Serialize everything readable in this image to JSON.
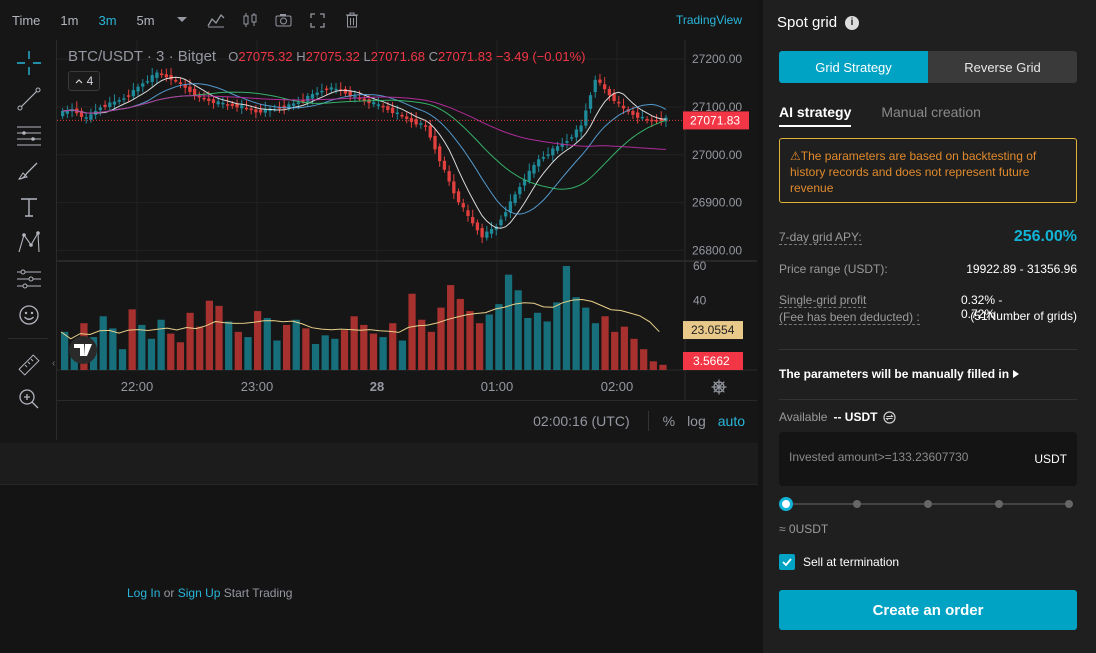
{
  "toolbar": {
    "time_label": "Time",
    "intervals": [
      "1m",
      "3m",
      "5m"
    ],
    "active_interval": "3m",
    "tradingview_label": "TradingView"
  },
  "chart": {
    "symbol": "BTC/USDT · 3 · Bitget",
    "ohlc": {
      "o_label": "O",
      "o": "27075.32",
      "h_label": "H",
      "h": "27075.32",
      "l_label": "L",
      "l": "27071.68",
      "c_label": "C",
      "c": "27071.83",
      "change": "−3.49 (−0.01%)"
    },
    "indicator_count": "4",
    "price_axis": [
      "27200.00",
      "27100.00",
      "27000.00",
      "26900.00",
      "26800.00"
    ],
    "last_price_badge": "27071.83",
    "volume_axis": [
      "60",
      "40"
    ],
    "volume_ma_badge": "23.0554",
    "volume_badge": "3.5662",
    "time_axis": [
      "22:00",
      "23:00",
      "28",
      "01:00",
      "02:00"
    ],
    "colors": {
      "up": "#1e8a9a",
      "down": "#e2403e",
      "volume_up": "#176f7c",
      "volume_down": "#a7312f",
      "accent": "#29b6d9"
    }
  },
  "chart_data": {
    "type": "candlestick",
    "price_range": [
      26780,
      27240
    ],
    "volume_range": [
      0,
      60
    ],
    "price_path": [
      27085,
      27095,
      27075,
      27100,
      27110,
      27125,
      27150,
      27170,
      27160,
      27140,
      27120,
      27110,
      27105,
      27100,
      27090,
      27095,
      27100,
      27110,
      27125,
      27140,
      27135,
      27120,
      27110,
      27100,
      27085,
      27070,
      27060,
      26990,
      26920,
      26870,
      26830,
      26850,
      26900,
      26950,
      26990,
      27010,
      27030,
      27060,
      27160,
      27125,
      27095,
      27080,
      27070,
      27075
    ],
    "volume_values": [
      22,
      14,
      27,
      19,
      31,
      24,
      12,
      35,
      26,
      18,
      29,
      21,
      16,
      33,
      25,
      40,
      37,
      28,
      22,
      19,
      34,
      30,
      17,
      26,
      29,
      24,
      15,
      20,
      18,
      23,
      31,
      26,
      21,
      19,
      27,
      17,
      44,
      29,
      22,
      36,
      49,
      41,
      34,
      27,
      32,
      38,
      55,
      46,
      30,
      33,
      28,
      39,
      60,
      42,
      36,
      27,
      31,
      22,
      25,
      18,
      12,
      5,
      3
    ]
  },
  "bottom_bar": {
    "time": "02:00:16 (UTC)",
    "pct": "%",
    "log": "log",
    "auto": "auto"
  },
  "login": {
    "login_label": "Log In",
    "or_label": "or",
    "signup_label": "Sign Up",
    "trail_label": "Start Trading"
  },
  "panel": {
    "title": "Spot grid",
    "segment_grid": "Grid Strategy",
    "segment_reverse": "Reverse Grid",
    "tab_ai": "AI strategy",
    "tab_manual": "Manual creation",
    "warning": "⚠The parameters are based on backtesting of history records and does not represent future revenue",
    "apy_label": "7-day grid APY:",
    "apy_value": "256.00%",
    "range_label": "Price range (USDT):",
    "range_value": "19922.89 - 31356.96",
    "profit_label": "Single-grid profit",
    "profit_sub": "(Fee has been deducted) :",
    "profit_value": "0.32% - 0.72%",
    "grids_value": "(51Number of grids)",
    "manual_note": "The parameters will be manually filled in",
    "available_label": "Available",
    "available_value": "-- USDT",
    "invest_placeholder": "Invested amount>=133.23607730",
    "invest_unit": "USDT",
    "approx": "≈ 0USDT",
    "sell_label": "Sell at termination",
    "create_button": "Create an order"
  }
}
